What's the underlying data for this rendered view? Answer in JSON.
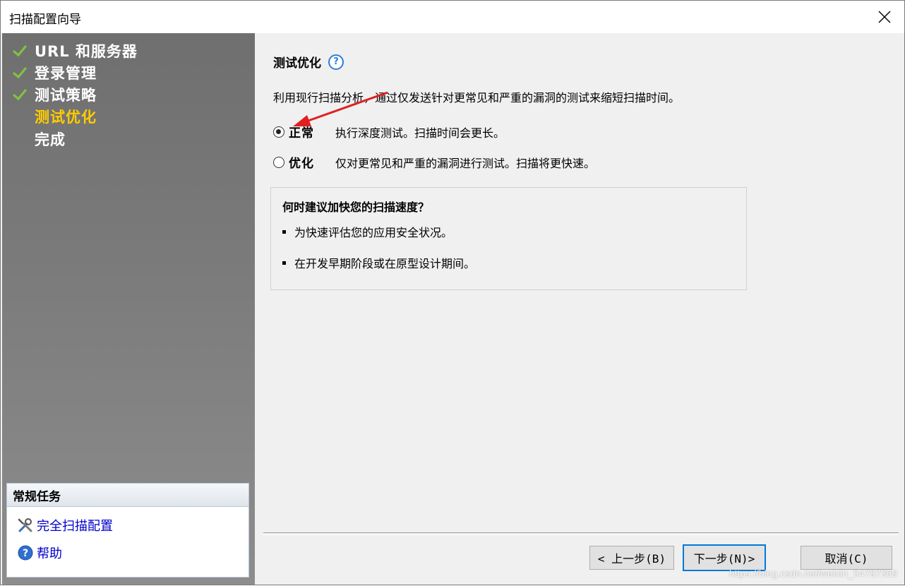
{
  "window": {
    "title": "扫描配置向导"
  },
  "sidebar": {
    "steps": [
      {
        "label": "URL 和服务器",
        "done": true
      },
      {
        "label": "登录管理",
        "done": true
      },
      {
        "label": "测试策略",
        "done": true
      },
      {
        "label": "测试优化",
        "current": true
      },
      {
        "label": "完成"
      }
    ],
    "tasks": {
      "title": "常规任务",
      "items": [
        {
          "label": "完全扫描配置",
          "icon": "tools-icon"
        },
        {
          "label": "帮助",
          "icon": "help-icon"
        }
      ]
    }
  },
  "main": {
    "heading": "测试优化",
    "help_glyph": "?",
    "description": "利用现行扫描分析，通过仅发送针对更常见和严重的漏洞的测试来缩短扫描时间。",
    "options": [
      {
        "label": "正常",
        "desc": "执行深度测试。扫描时间会更长。",
        "checked": true
      },
      {
        "label": "优化",
        "desc": "仅对更常见和严重的漏洞进行测试。扫描将更快速。",
        "checked": false
      }
    ],
    "info": {
      "title": "何时建议加快您的扫描速度？",
      "bullets": [
        "为快速评估您的应用安全状况。",
        "在开发早期阶段或在原型设计期间。"
      ]
    }
  },
  "buttons": {
    "back": "< 上一步(B)",
    "next": "下一步(N)>",
    "cancel": "取消(C)"
  },
  "watermark": "https://blog.csdn.net/weixin_54787369",
  "colors": {
    "current_step": "#ffcc00",
    "link": "#0000cc",
    "accent": "#0078d7",
    "annotation_arrow": "#e02020"
  }
}
